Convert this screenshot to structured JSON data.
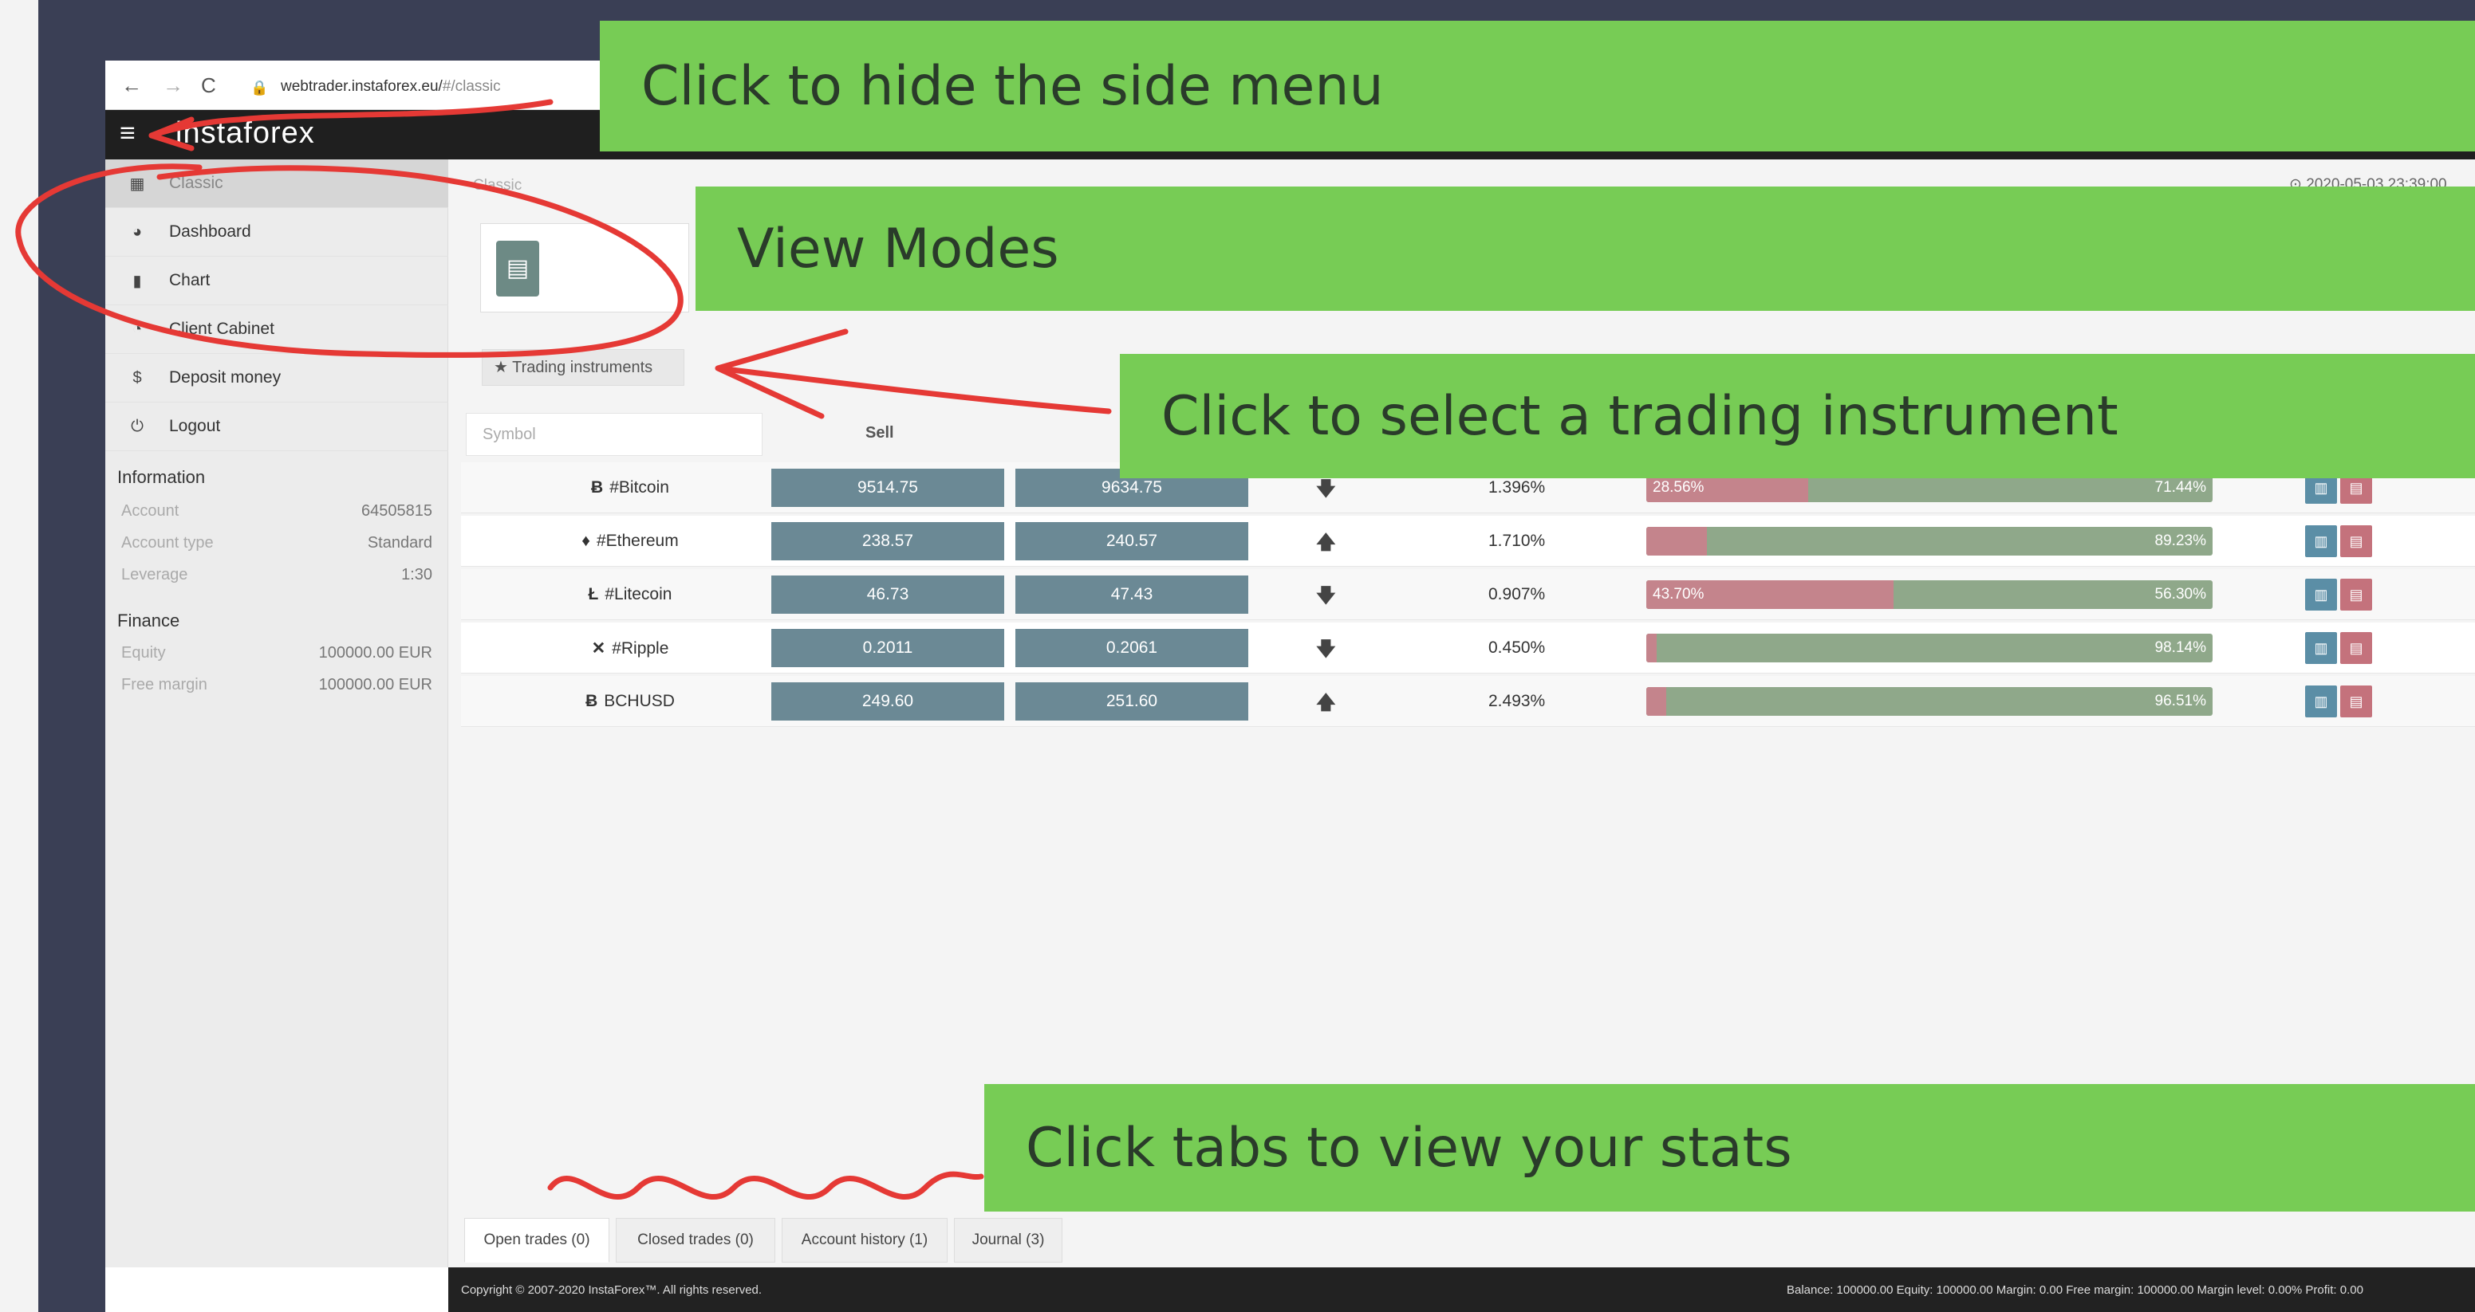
{
  "browser": {
    "url_host": "webtrader.instaforex.eu/",
    "url_path": "#/classic"
  },
  "app": {
    "logo": "instaforex"
  },
  "sidebar": {
    "items": [
      {
        "label": "Classic",
        "icon": "table-icon",
        "active": true
      },
      {
        "label": "Dashboard",
        "icon": "dashboard-icon",
        "active": false
      },
      {
        "label": "Chart",
        "icon": "bar-chart-icon",
        "active": false
      },
      {
        "label": "Client Cabinet",
        "icon": "user-icon",
        "active": false
      },
      {
        "label": "Deposit money",
        "icon": "dollar-icon",
        "active": false
      },
      {
        "label": "Logout",
        "icon": "power-icon",
        "active": false
      }
    ],
    "information_title": "Information",
    "information": [
      {
        "label": "Account",
        "value": "64505815"
      },
      {
        "label": "Account type",
        "value": "Standard"
      },
      {
        "label": "Leverage",
        "value": "1:30"
      }
    ],
    "finance_title": "Finance",
    "finance": [
      {
        "label": "Equity",
        "value": "100000.00 EUR"
      },
      {
        "label": "Free margin",
        "value": "100000.00 EUR"
      }
    ]
  },
  "main": {
    "breadcrumb": "Classic",
    "clock": "⊙ 2020-05-03 23:39:00",
    "trading_instruments_button": "★ Trading instruments",
    "symbol_placeholder": "Symbol",
    "sell_header": "Sell"
  },
  "instruments": [
    {
      "coin": "Ƀ",
      "symbol": "#Bitcoin",
      "sell": "9514.75",
      "buy": "9634.75",
      "direction": "down",
      "change": "1.396%",
      "sell_pct": 28.56,
      "buy_pct": 71.44,
      "sell_label": "28.56%",
      "buy_label": "71.44%"
    },
    {
      "coin": "♦",
      "symbol": "#Ethereum",
      "sell": "238.57",
      "buy": "240.57",
      "direction": "up",
      "change": "1.710%",
      "sell_pct": 10.77,
      "buy_pct": 89.23,
      "sell_label": "",
      "buy_label": "89.23%"
    },
    {
      "coin": "Ł",
      "symbol": "#Litecoin",
      "sell": "46.73",
      "buy": "47.43",
      "direction": "down",
      "change": "0.907%",
      "sell_pct": 43.7,
      "buy_pct": 56.3,
      "sell_label": "43.70%",
      "buy_label": "56.30%"
    },
    {
      "coin": "✕",
      "symbol": "#Ripple",
      "sell": "0.2011",
      "buy": "0.2061",
      "direction": "down",
      "change": "0.450%",
      "sell_pct": 1.86,
      "buy_pct": 98.14,
      "sell_label": "",
      "buy_label": "98.14%"
    },
    {
      "coin": "Ƀ",
      "symbol": "BCHUSD",
      "sell": "249.60",
      "buy": "251.60",
      "direction": "up",
      "change": "2.493%",
      "sell_pct": 3.49,
      "buy_pct": 96.51,
      "sell_label": "",
      "buy_label": "96.51%"
    }
  ],
  "tabs": [
    "Open trades (0)",
    "Closed trades (0)",
    "Account history (1)",
    "Journal (3)"
  ],
  "footer": {
    "copyright": "Copyright © 2007-2020 InstaForex™. All rights reserved.",
    "balance": "Balance: 100000.00 Equity: 100000.00 Margin: 0.00 Free margin: 100000.00 Margin level: 0.00% Profit: 0.00"
  },
  "annotations": {
    "hide_menu": "Click to hide the side menu",
    "view_modes": "View Modes",
    "select_instrument": "Click to select a trading instrument",
    "tabs_stats": "Click tabs to view your stats"
  },
  "colors": {
    "banner": "#77cc55",
    "price_button": "#6b8995",
    "sell_bar": "#c4848c",
    "buy_bar": "#8fa88a",
    "annotation_red": "#e53935"
  }
}
